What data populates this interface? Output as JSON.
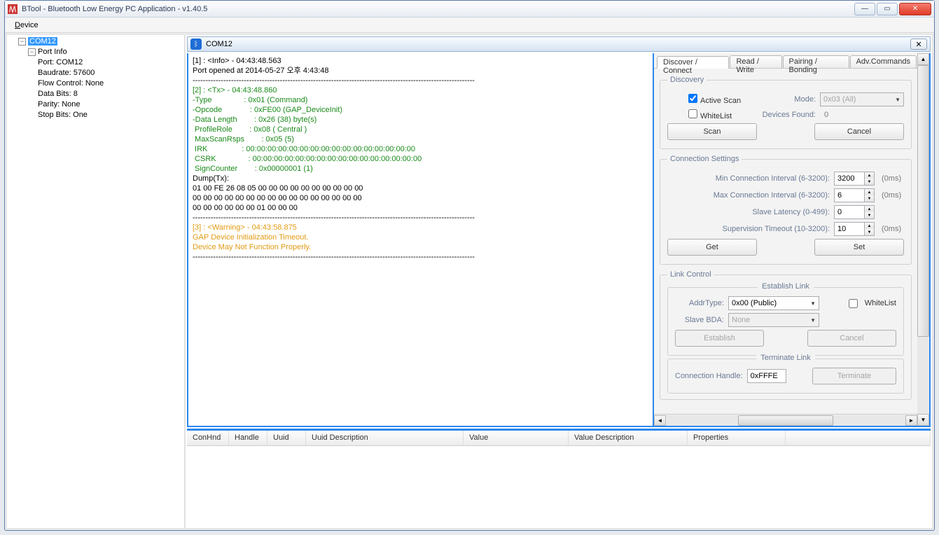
{
  "title": "BTool - Bluetooth Low Energy PC Application - v1.40.5",
  "menu": {
    "device": "Device"
  },
  "tree": {
    "root": "COM12",
    "portinfo": "Port Info",
    "port": "Port: COM12",
    "baud": "Baudrate: 57600",
    "flow": "Flow Control: None",
    "databits": "Data Bits: 8",
    "parity": "Parity: None",
    "stopbits": "Stop Bits: One"
  },
  "com": {
    "header": "COM12"
  },
  "log": {
    "info1": "[1] : <Info> - 04:43:48.563",
    "info2": "Port opened at 2014-05-27 오후 4:43:48",
    "dash": "--------------------------------------------------------------------------------------------------------------",
    "tx_head": "[2] : <Tx> - 04:43:48.860",
    "tx_type": "-Type               : 0x01 (Command)",
    "tx_opcode": "-Opcode             : 0xFE00 (GAP_DeviceInit)",
    "tx_datalen": "-Data Length        : 0x26 (38) byte(s)",
    "tx_profile": " ProfileRole        : 0x08 ( Central )",
    "tx_maxscan": " MaxScanRsps        : 0x05 (5)",
    "tx_irk": " IRK                : 00:00:00:00:00:00:00:00:00:00:00:00:00:00:00:00",
    "tx_csrk": " CSRK               : 00:00:00:00:00:00:00:00:00:00:00:00:00:00:00:00",
    "tx_sign": " SignCounter        : 0x00000001 (1)",
    "dump_head": "Dump(Tx):",
    "dump1": "01 00 FE 26 08 05 00 00 00 00 00 00 00 00 00 00",
    "dump2": "00 00 00 00 00 00 00 00 00 00 00 00 00 00 00 00",
    "dump3": "00 00 00 00 00 00 01 00 00 00",
    "warn_head": "[3] : <Warning> - 04:43:58.875",
    "warn1": "GAP Device Initialization Timeout.",
    "warn2": "Device May Not Function Properly."
  },
  "tabs": {
    "discover": "Discover / Connect",
    "read": "Read / Write",
    "pairing": "Pairing / Bonding",
    "adv": "Adv.Commands"
  },
  "discovery": {
    "legend": "Discovery",
    "activescan": "Active Scan",
    "whitelist": "WhiteList",
    "mode_lbl": "Mode:",
    "mode_val": "0x03 (All)",
    "found_lbl": "Devices Found:",
    "found_val": "0",
    "scan": "Scan",
    "cancel": "Cancel"
  },
  "conn": {
    "legend": "Connection Settings",
    "min_lbl": "Min Connection Interval (6-3200):",
    "min_val": "3200",
    "max_lbl": "Max Connection Interval (6-3200):",
    "max_val": "6",
    "lat_lbl": "Slave Latency (0-499):",
    "lat_val": "0",
    "sup_lbl": "Supervision Timeout (10-3200):",
    "sup_val": "10",
    "unit": "(0ms)",
    "get": "Get",
    "set": "Set"
  },
  "link": {
    "legend": "Link Control",
    "establish": "Establish Link",
    "addrtype_lbl": "AddrType:",
    "addrtype_val": "0x00 (Public)",
    "whitelist": "WhiteList",
    "slavebda_lbl": "Slave BDA:",
    "slavebda_val": "None",
    "establish_btn": "Establish",
    "cancel_btn": "Cancel",
    "terminate": "Terminate Link",
    "connhandle_lbl": "Connection Handle:",
    "connhandle_val": "0xFFFE",
    "terminate_btn": "Terminate"
  },
  "table": {
    "conhnd": "ConHnd",
    "handle": "Handle",
    "uuid": "Uuid",
    "uuiddesc": "Uuid Description",
    "value": "Value",
    "valuedesc": "Value Description",
    "props": "Properties"
  }
}
